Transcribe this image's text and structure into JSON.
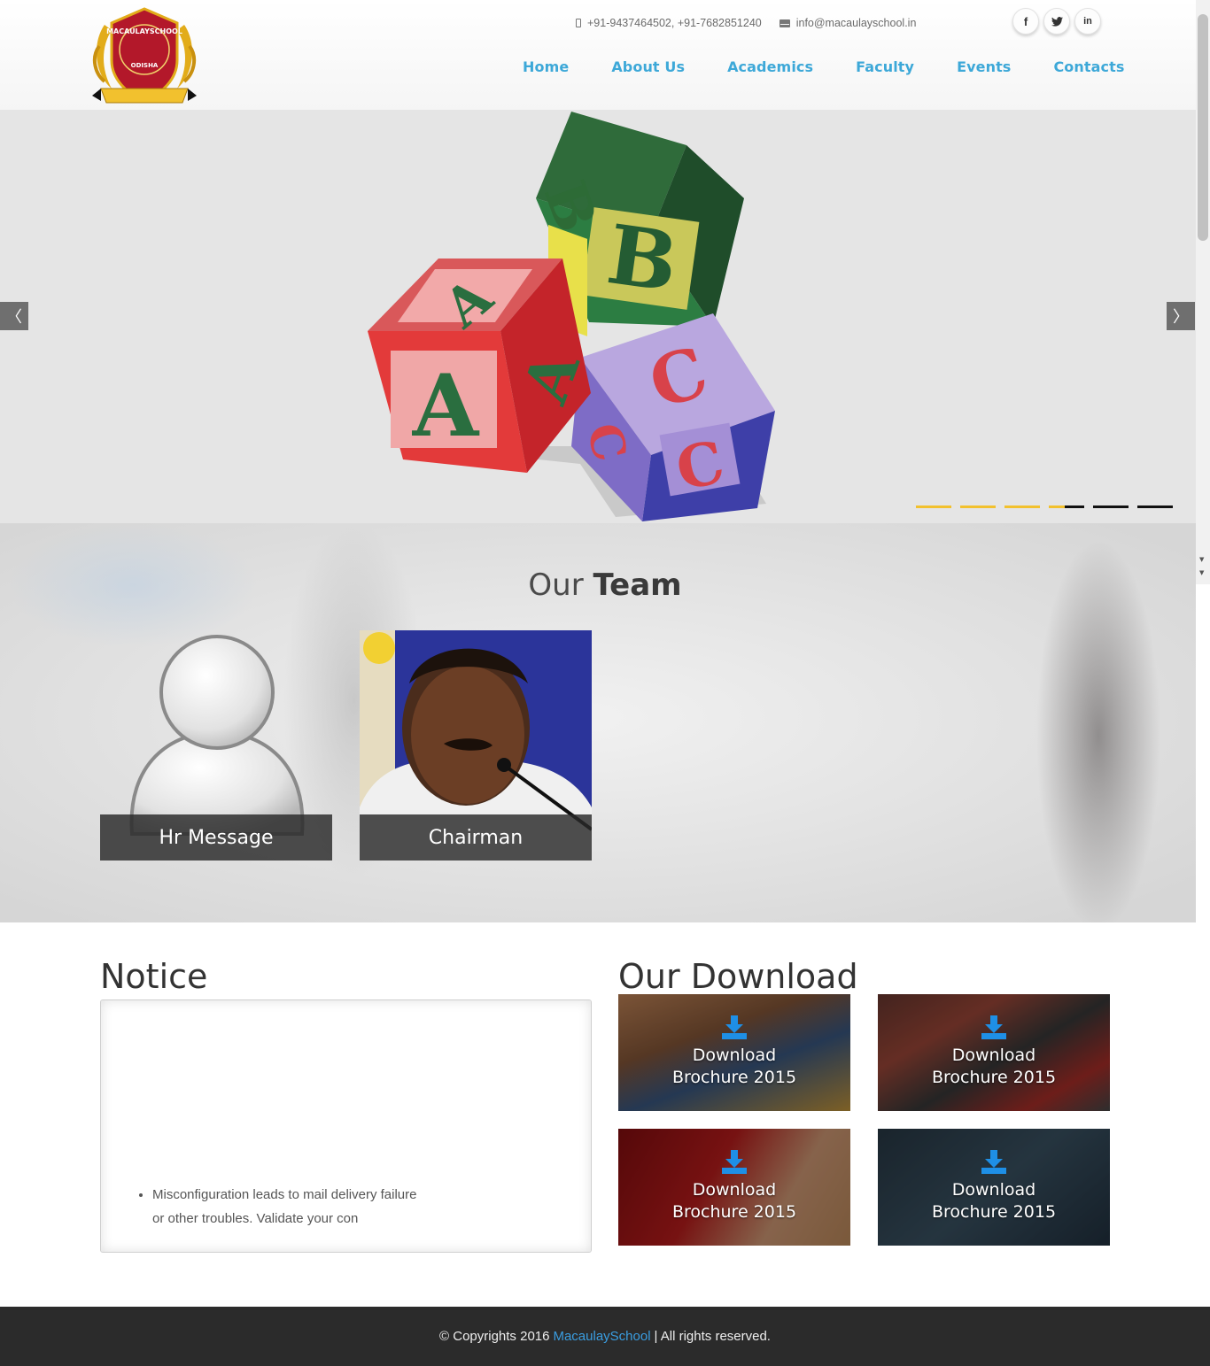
{
  "header": {
    "logo": {
      "top_text": "MACAULAYSCHOOL",
      "bottom_text": "ODISHA",
      "colors": {
        "shield": "#b3182a",
        "gold": "#e2ac1a"
      }
    },
    "phone": "+91-9437464502, +91-7682851240",
    "email": "info@macaulayschool.in",
    "social": [
      {
        "icon": "facebook-icon",
        "glyph": "f"
      },
      {
        "icon": "twitter-icon",
        "glyph": "🐦"
      },
      {
        "icon": "linkedin-icon",
        "glyph": "in"
      }
    ]
  },
  "nav": {
    "items": [
      "Home",
      "About Us",
      "Academics",
      "Faculty",
      "Events",
      "Contacts"
    ],
    "color": "#3da8d8"
  },
  "slider": {
    "prev_glyph": "〈",
    "next_glyph": "〉",
    "progress": "slide 4 of 6 in progress",
    "accent": "#f2c12e",
    "block_letters": [
      "A",
      "B",
      "C"
    ]
  },
  "team": {
    "title_light": "Our ",
    "title_bold": "Team",
    "members": [
      {
        "caption": "Hr Message"
      },
      {
        "caption": "Chairman"
      }
    ]
  },
  "notice": {
    "heading": "Notice",
    "items": [
      "Misconfiguration leads to mail delivery failure or other troubles. Validate your con"
    ]
  },
  "downloads": {
    "heading": "Our Download",
    "icon": "download-icon",
    "icon_color": "#1e8fe6",
    "items": [
      {
        "label_line1": "Download",
        "label_line2": "Brochure 2015"
      },
      {
        "label_line1": "Download",
        "label_line2": "Brochure 2015"
      },
      {
        "label_line1": "Download",
        "label_line2": "Brochure 2015"
      },
      {
        "label_line1": "Download",
        "label_line2": "Brochure 2015"
      }
    ]
  },
  "footer": {
    "prefix": "© Copyrights 2016",
    "brand": "MacaulaySchool",
    "suffix": "| All rights reserved.",
    "brand_color": "#3a9de0"
  }
}
